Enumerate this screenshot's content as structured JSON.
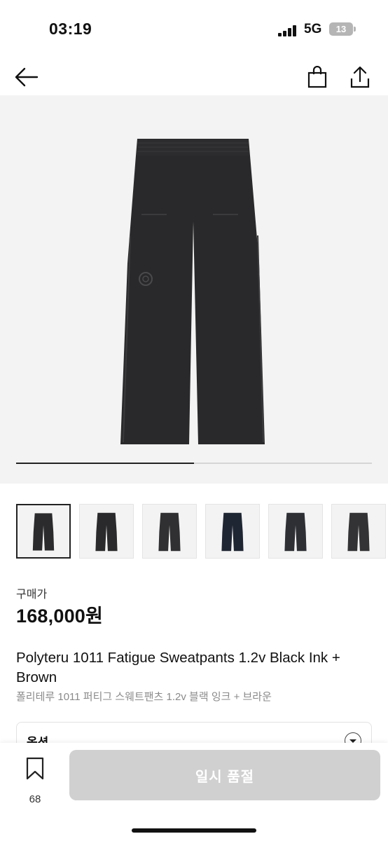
{
  "status_bar": {
    "time": "03:19",
    "network": "5G",
    "battery": "13"
  },
  "nav": {
    "back_icon": "arrow-left-icon",
    "cart_icon": "shopping-bag-icon",
    "share_icon": "share-icon"
  },
  "gallery": {
    "progress": 0.5,
    "pants_color": "#2a2a2c",
    "background": "#f3f3f3"
  },
  "thumbnails": [
    {
      "color": "#2b2b2d",
      "selected": true
    },
    {
      "color": "#2a2a2c",
      "selected": false
    },
    {
      "color": "#303032",
      "selected": false
    },
    {
      "color": "#1f2633",
      "selected": false
    },
    {
      "color": "#2d2f35",
      "selected": false
    },
    {
      "color": "#333335",
      "selected": false
    }
  ],
  "product": {
    "price_label": "구매가",
    "price": "168,000원",
    "name": "Polyteru 1011 Fatigue Sweatpants 1.2v Black Ink + Brown",
    "name_ko": "폴리테루 1011 퍼티그 스웨트팬츠 1.2v 블랙 잉크 + 브라운"
  },
  "option": {
    "label": "옵션"
  },
  "bottom": {
    "wish_count": "68",
    "button_label": "일시 품절",
    "button_color": "#d0d0d0"
  }
}
